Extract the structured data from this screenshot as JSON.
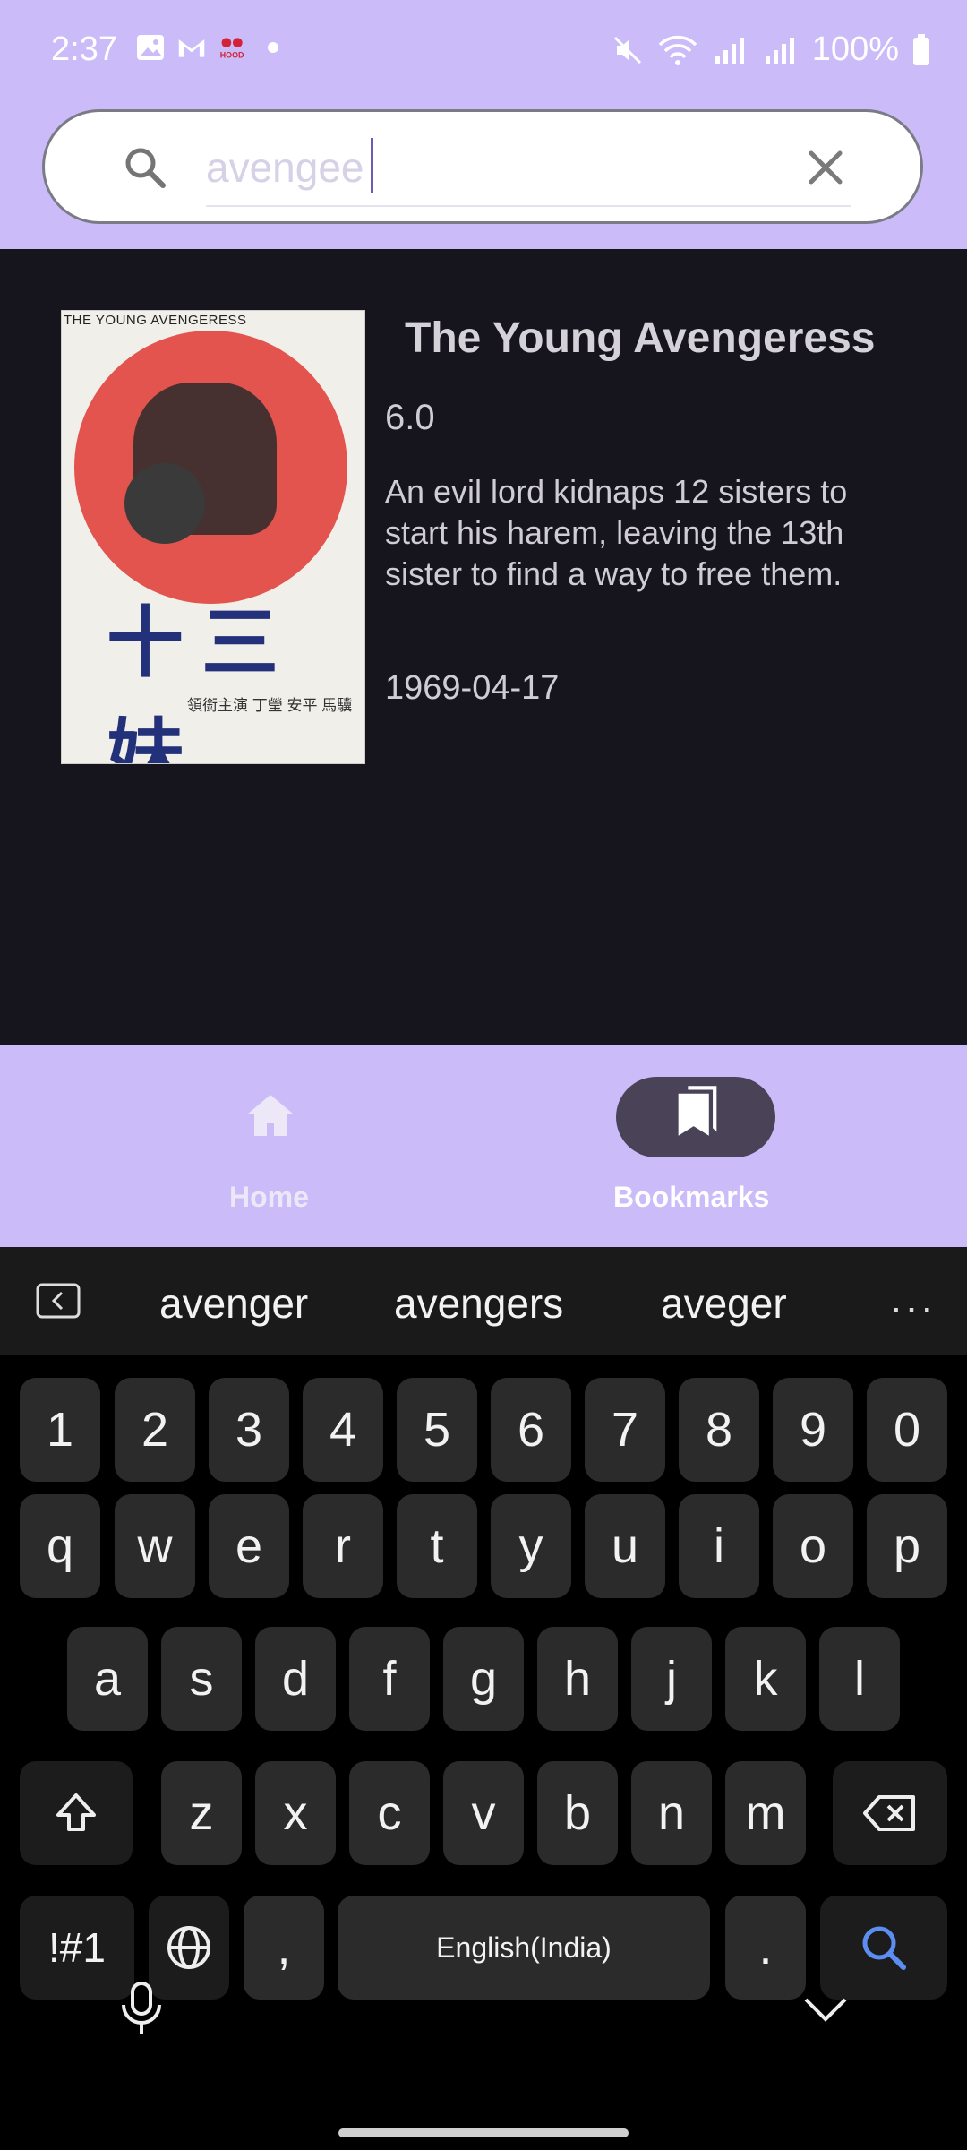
{
  "status_bar": {
    "time": "2:37",
    "battery": "100%",
    "icons": [
      "gallery-icon",
      "gmail-icon",
      "hood-app-icon",
      "dot-icon",
      "mute-icon",
      "wifi-icon",
      "signal-icon",
      "signal-icon",
      "battery-icon"
    ]
  },
  "search": {
    "value": "avengee",
    "clear_icon": "close-icon",
    "search_icon": "search-icon"
  },
  "result": {
    "title": "The Young Avengeress",
    "rating": "6.0",
    "overview": "An evil lord kidnaps 12 sisters to start his harem, leaving the 13th sister to find a way to free them.",
    "release_date": "1969-04-17",
    "poster": {
      "top_text": "THE YOUNG AVENGERESS",
      "main_chars": "十三妹",
      "credits": "領銜主演 丁瑩 安平 馬驥"
    }
  },
  "bottom_nav": {
    "items": [
      {
        "label": "Home",
        "icon": "home-icon",
        "selected": false
      },
      {
        "label": "Bookmarks",
        "icon": "bookmarks-icon",
        "selected": true
      }
    ]
  },
  "keyboard": {
    "suggestions": [
      "avenger",
      "avengers",
      "aveger"
    ],
    "more": "···",
    "row_numbers": [
      "1",
      "2",
      "3",
      "4",
      "5",
      "6",
      "7",
      "8",
      "9",
      "0"
    ],
    "row_q": [
      "q",
      "w",
      "e",
      "r",
      "t",
      "y",
      "u",
      "i",
      "o",
      "p"
    ],
    "row_a": [
      "a",
      "s",
      "d",
      "f",
      "g",
      "h",
      "j",
      "k",
      "l"
    ],
    "row_z": [
      "z",
      "x",
      "c",
      "v",
      "b",
      "n",
      "m"
    ],
    "symbols_key": "!#1",
    "comma": ",",
    "space": "English(India)",
    "period": "."
  },
  "colors": {
    "accent": "#cbbcf9",
    "content_bg": "#16141c",
    "nav_pill": "#4a4358",
    "search_key_icon": "#5b8ef0"
  }
}
